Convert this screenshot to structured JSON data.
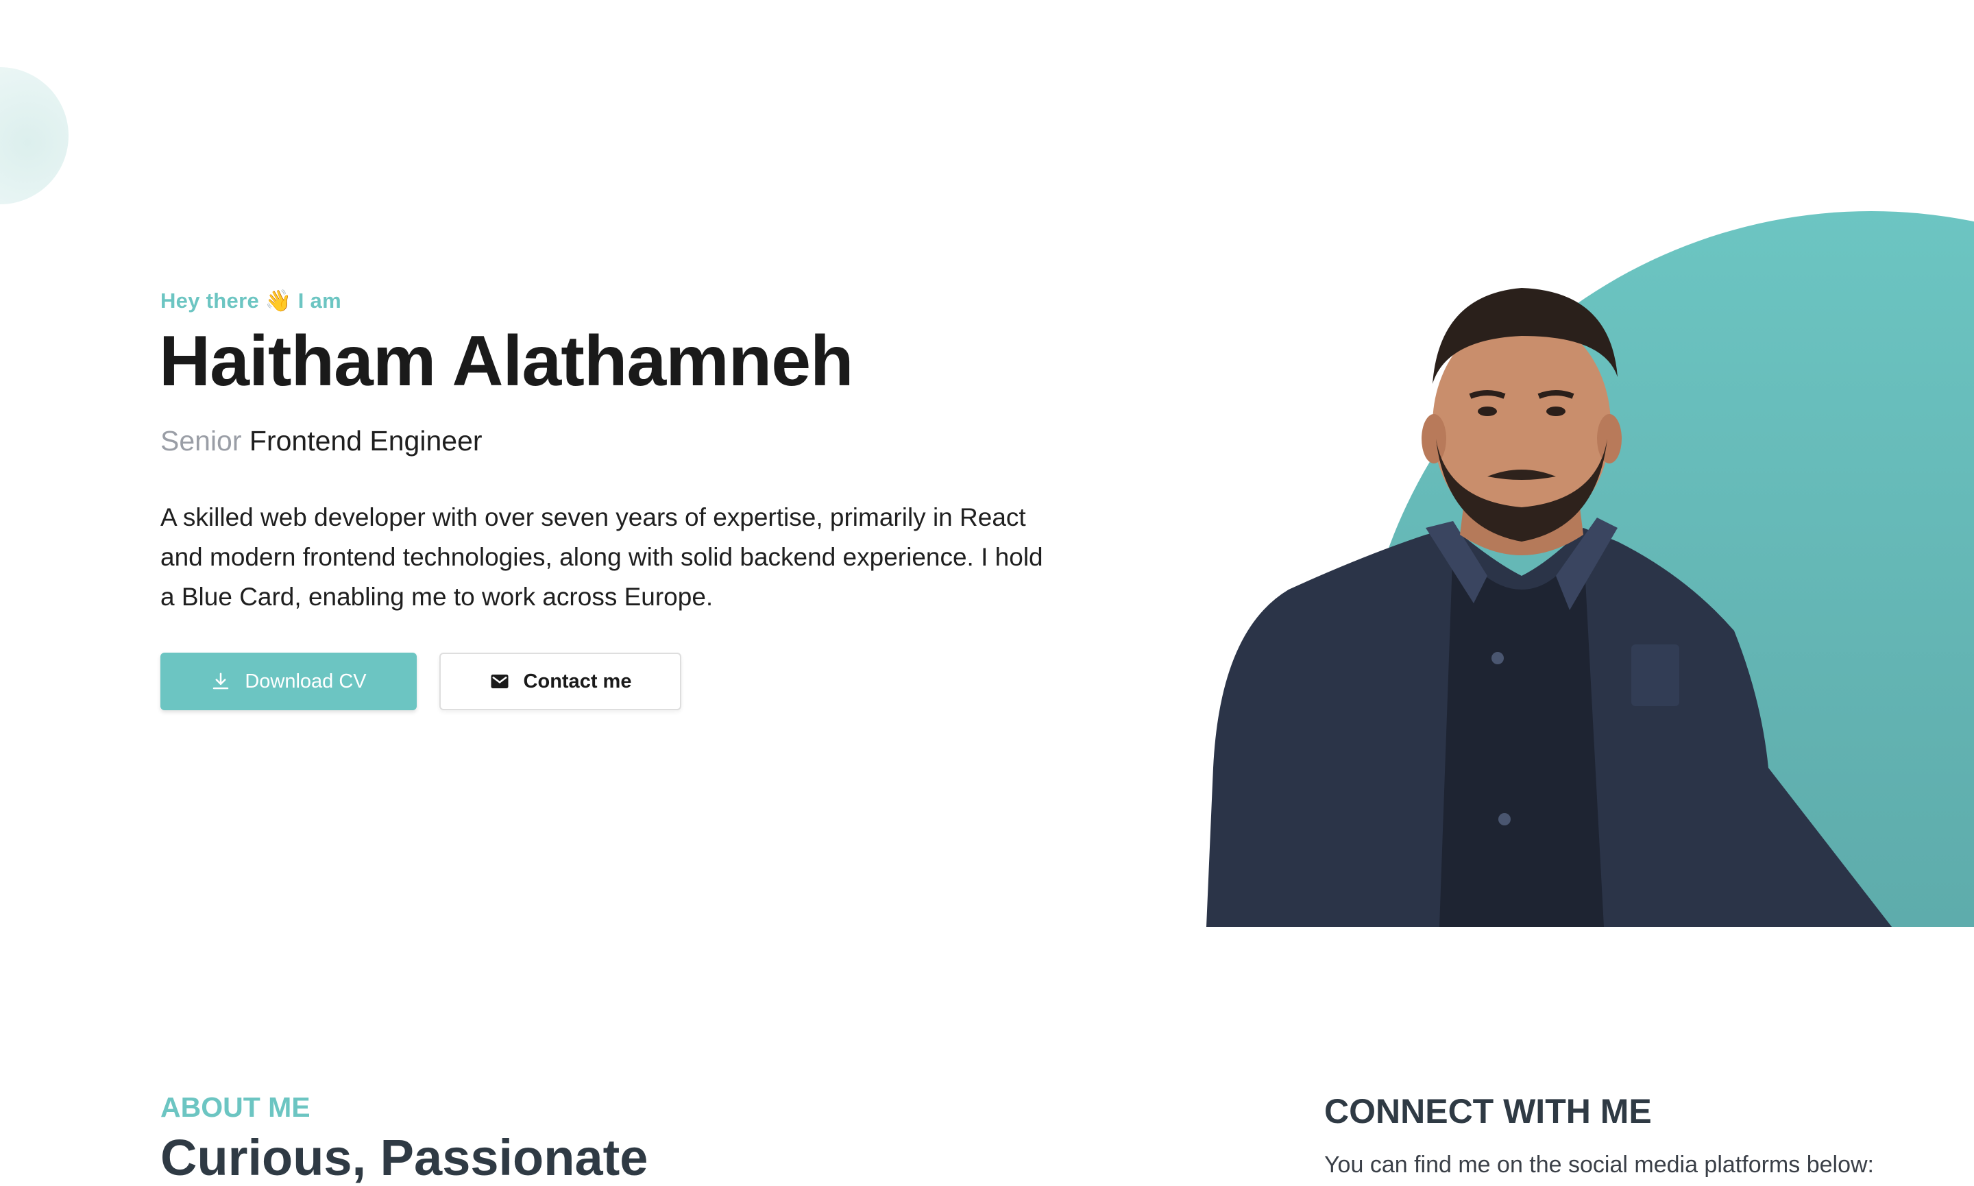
{
  "hero": {
    "greeting": "Hey there 👋 I am",
    "name": "Haitham Alathamneh",
    "role_level": "Senior",
    "role_title": "Frontend Engineer",
    "bio": "A skilled web developer with over seven years of expertise, primarily in React and modern frontend technologies, along with solid backend experience. I hold a Blue Card, enabling me to work across Europe.",
    "download_cv_label": "Download CV",
    "contact_label": "Contact me"
  },
  "about": {
    "label": "ABOUT ME",
    "heading": "Curious, Passionate"
  },
  "connect": {
    "heading": "CONNECT WITH ME",
    "text": "You can find me on the social media platforms below:"
  },
  "colors": {
    "accent": "#6cc5c2",
    "heading_dark": "#2f3a44",
    "muted": "#9a9ea6",
    "jacket": "#2b3448"
  },
  "icons": {
    "download": "download-icon",
    "mail": "mail-icon",
    "portrait": "portrait-image"
  }
}
